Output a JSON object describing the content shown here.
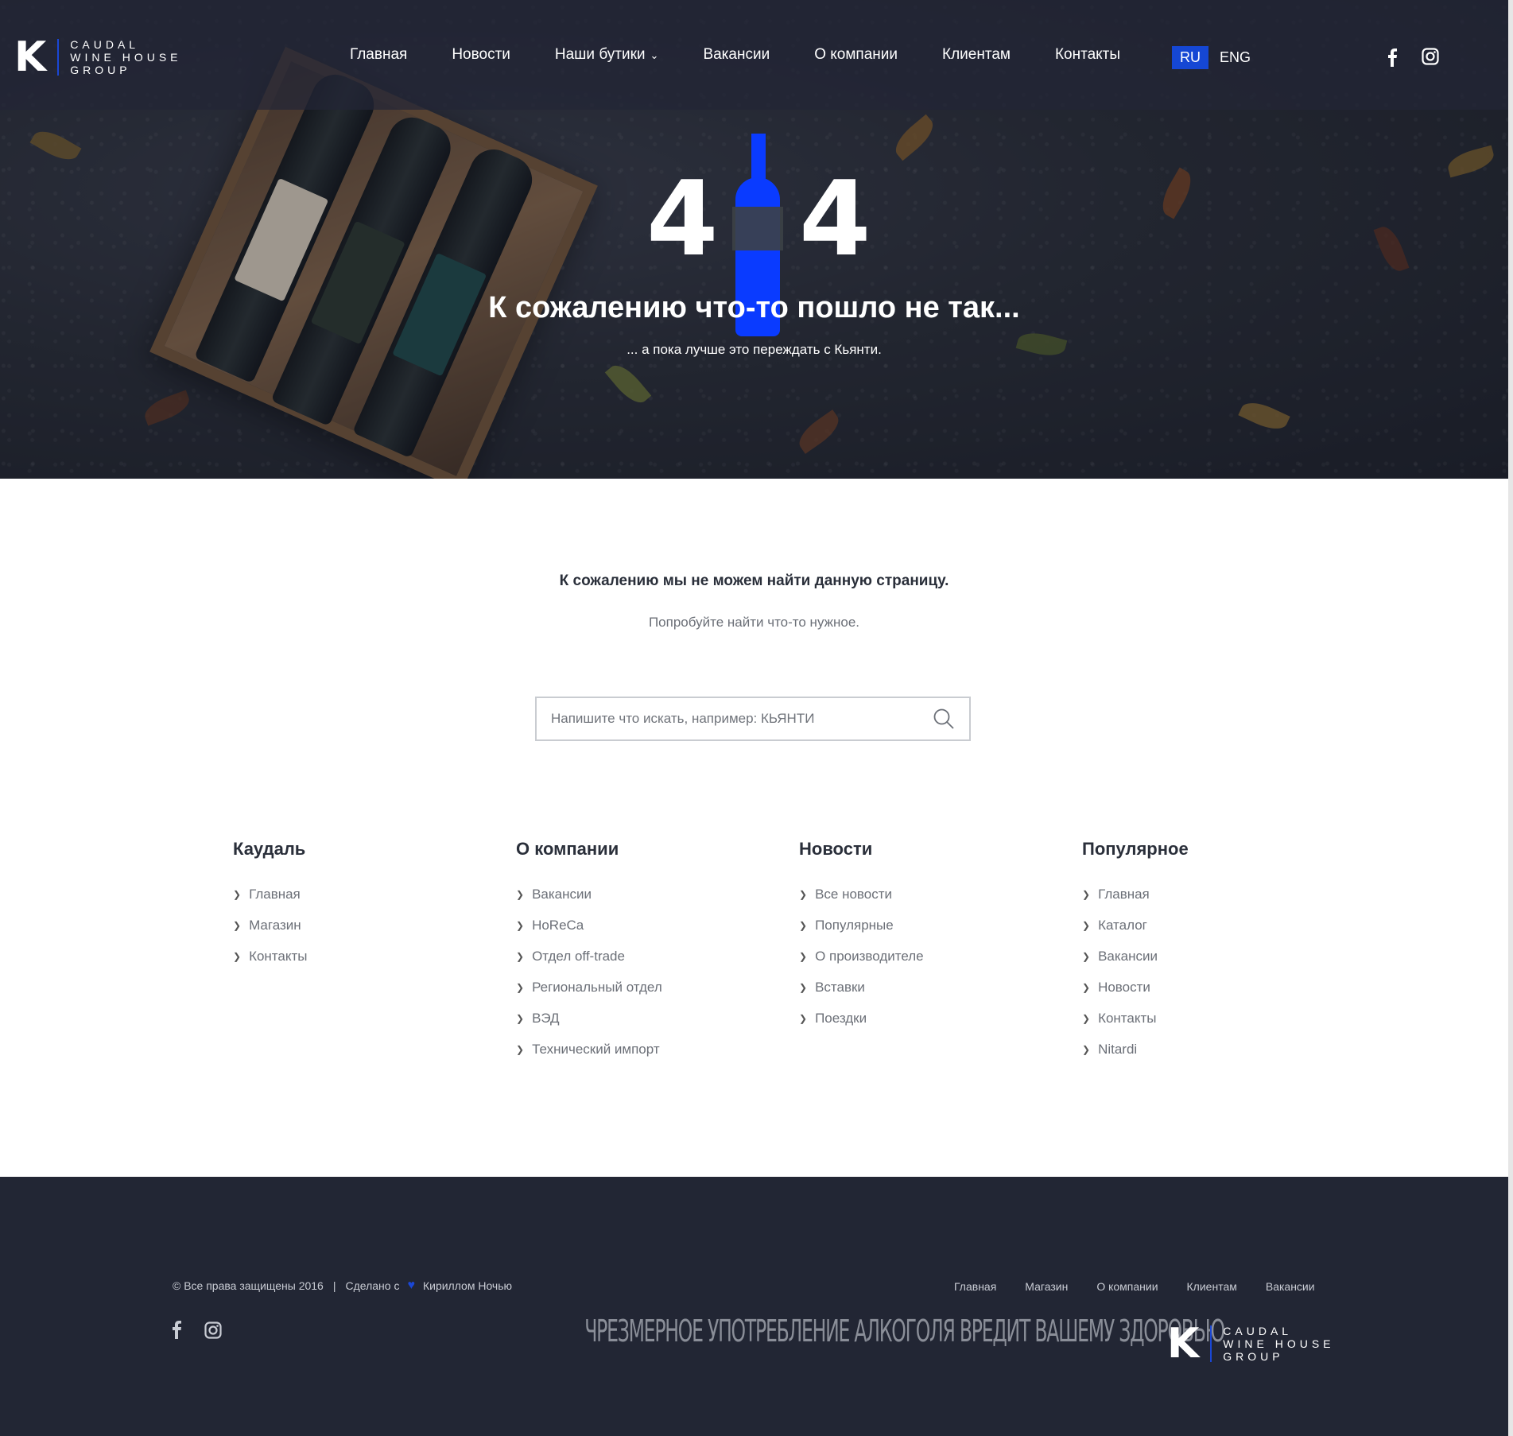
{
  "brand": {
    "letter": "K",
    "line1": "CAUDAL",
    "line2": "WINE HOUSE",
    "line3": "GROUP"
  },
  "nav": [
    {
      "label": "Главная"
    },
    {
      "label": "Новости"
    },
    {
      "label": "Наши бутики",
      "dropdown": true
    },
    {
      "label": "Вакансии"
    },
    {
      "label": "О компании"
    },
    {
      "label": "Клиентам"
    },
    {
      "label": "Контакты"
    }
  ],
  "lang": {
    "active": "RU",
    "other": "ENG"
  },
  "social": {
    "facebook": "facebook-icon",
    "instagram": "instagram-icon"
  },
  "hero": {
    "code_left": "4",
    "code_right": "4",
    "title": "К сожалению что-то пошло не так...",
    "subtitle": "... а пока лучше это переждать с Кьянти."
  },
  "notfound": {
    "message": "К сожалению мы не можем найти данную страницу.",
    "hint": "Попробуйте найти что-то нужное."
  },
  "search": {
    "placeholder": "Напишите что искать, например: КЬЯНТИ",
    "value": ""
  },
  "columns": [
    {
      "title": "Каудаль",
      "items": [
        "Главная",
        "Магазин",
        "Контакты"
      ]
    },
    {
      "title": "О компании",
      "items": [
        "Вакансии",
        "HoReCa",
        "Отдел off-trade",
        "Региональный отдел",
        "ВЭД",
        "Технический импорт"
      ]
    },
    {
      "title": "Новости",
      "items": [
        "Все новости",
        "Популярные",
        "О производителе",
        "Вставки",
        "Поездки"
      ]
    },
    {
      "title": "Популярное",
      "items": [
        "Главная",
        "Каталог",
        "Вакансии",
        "Новости",
        "Контакты",
        "Nitardi"
      ]
    }
  ],
  "footer": {
    "copyright": "© Все права защищены 2016",
    "separator": "|",
    "made_with": "Сделано с",
    "author": "Кириллом Ночью",
    "links": [
      "Главная",
      "Магазин",
      "О компании",
      "Клиентам",
      "Вакансии"
    ],
    "warning": "ЧРЕЗМЕРНОЕ УПОТРЕБЛЕНИЕ АЛКОГОЛЯ ВРЕДИТ ВАШЕМУ ЗДОРОВЬЮ"
  },
  "colors": {
    "accent": "#1547d4",
    "bottle": "#0a3bff",
    "footer_bg": "#222634",
    "text_dark": "#2a2f3a"
  }
}
